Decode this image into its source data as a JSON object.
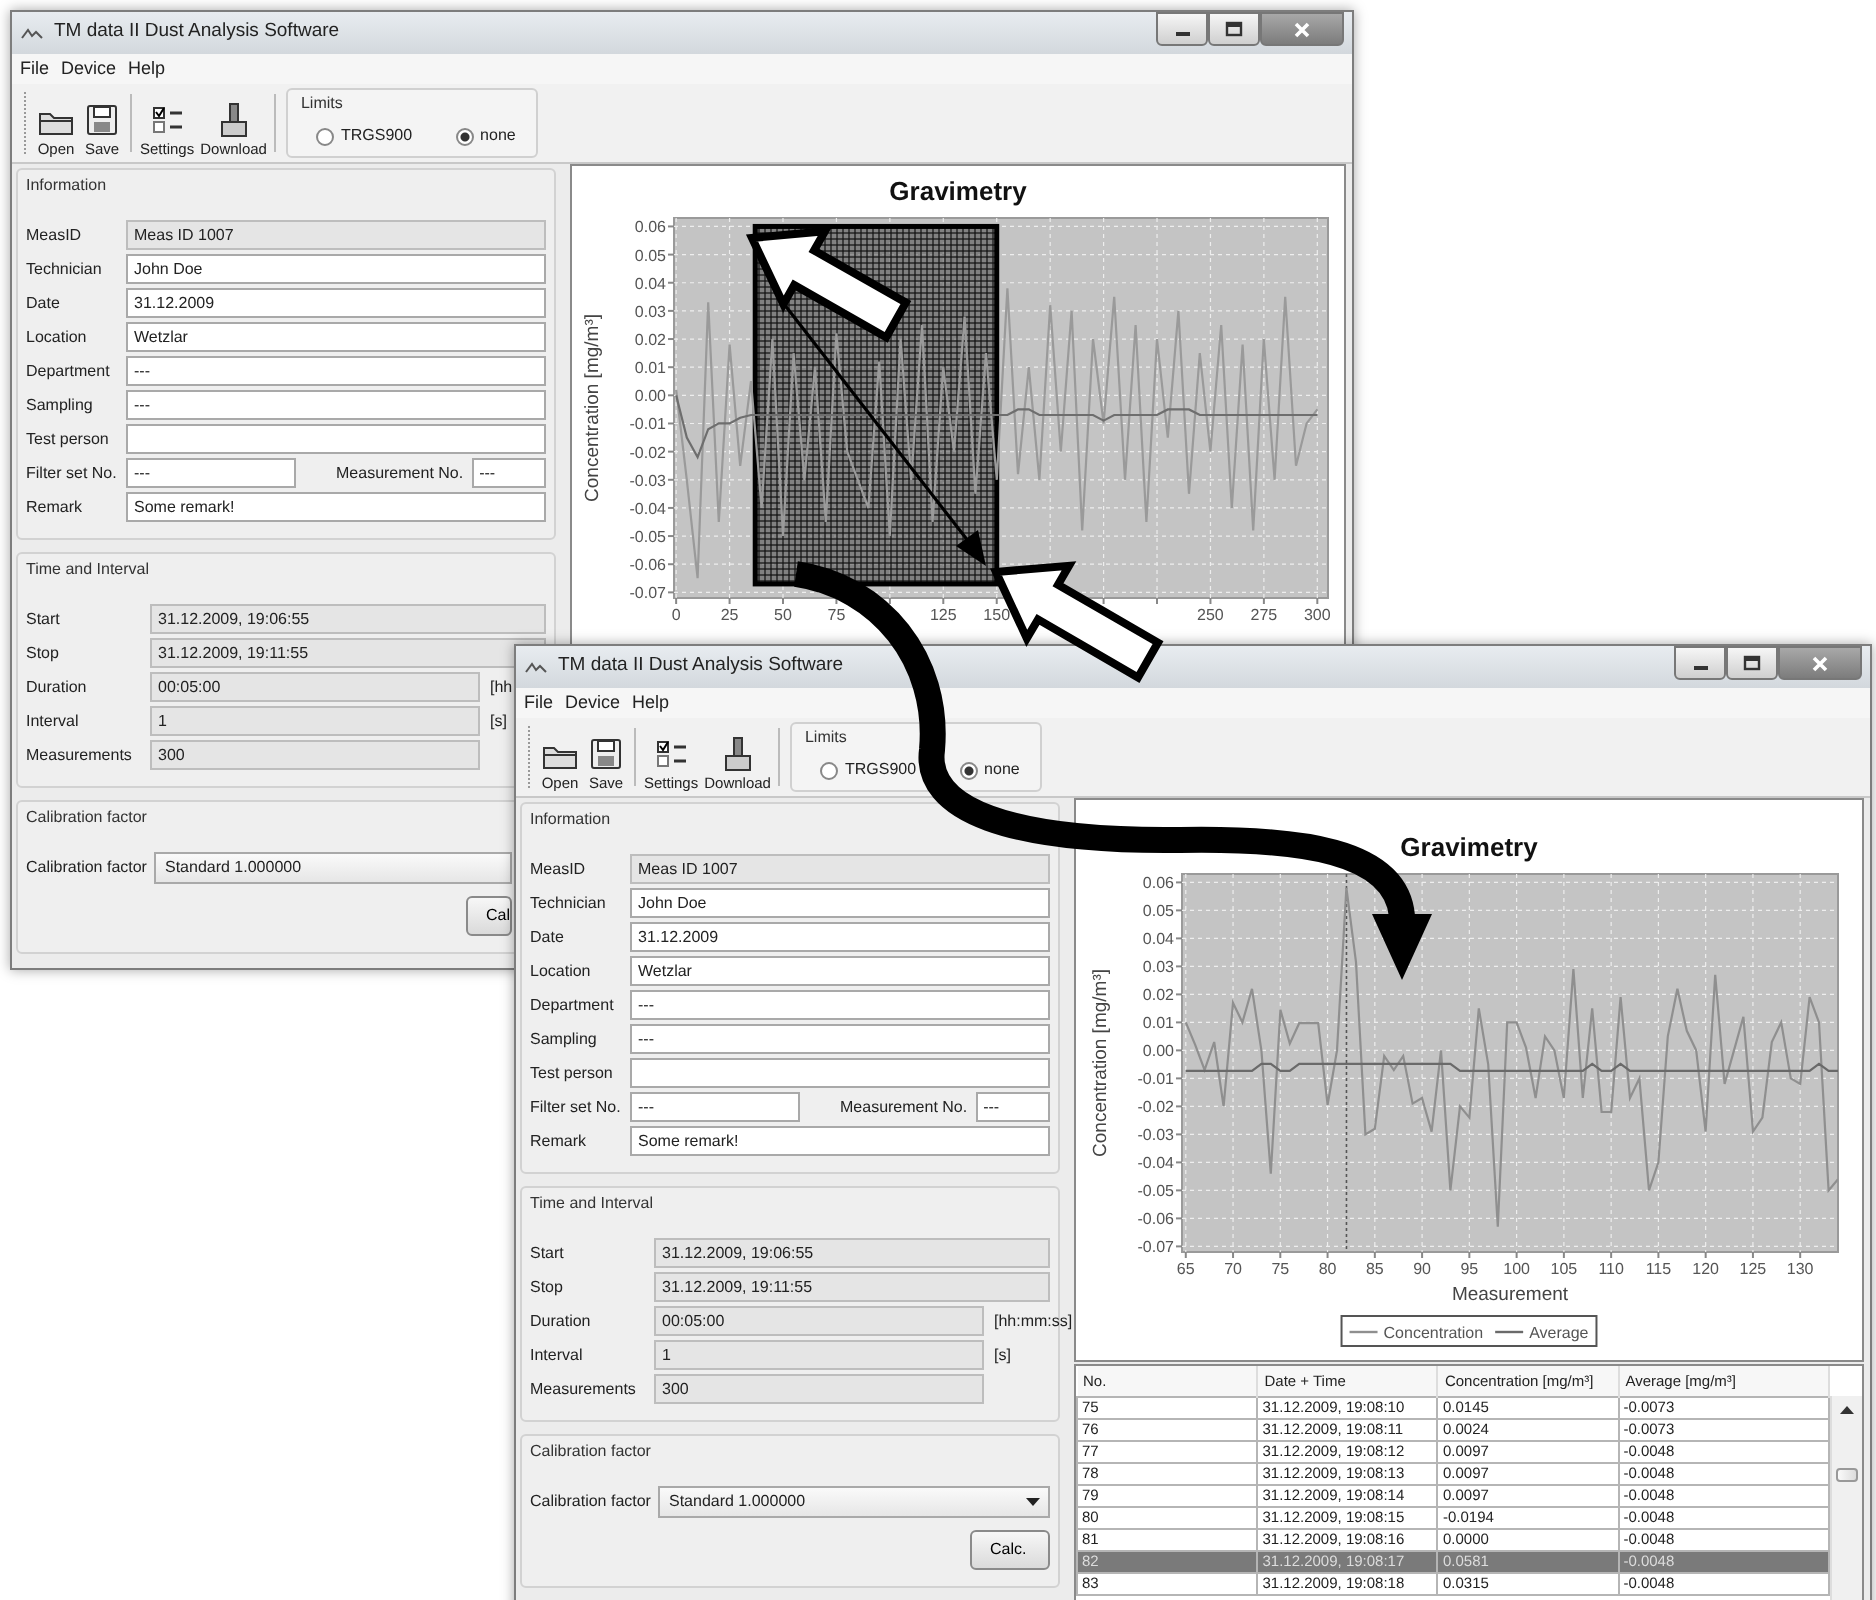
{
  "windows": [
    {
      "title": "TM data II Dust Analysis Software",
      "menu": [
        "File",
        "Device",
        "Help"
      ],
      "toolbar": [
        {
          "kind": "open",
          "label": "Open"
        },
        {
          "kind": "save",
          "label": "Save"
        },
        {
          "kind": "settings",
          "label": "Settings"
        },
        {
          "kind": "download",
          "label": "Download"
        }
      ],
      "limits": {
        "title": "Limits",
        "options": [
          {
            "label": "TRGS900",
            "selected": false
          },
          {
            "label": "none",
            "selected": true
          }
        ]
      },
      "information": {
        "title": "Information",
        "fields": [
          {
            "label": "MeasID",
            "value": "Meas ID 1007",
            "readonly": true
          },
          {
            "label": "Technician",
            "value": "John Doe",
            "readonly": false
          },
          {
            "label": "Date",
            "value": "31.12.2009",
            "readonly": false
          },
          {
            "label": "Location",
            "value": "Wetzlar",
            "readonly": false
          },
          {
            "label": "Department",
            "value": "---",
            "readonly": false
          },
          {
            "label": "Sampling",
            "value": "---",
            "readonly": false
          },
          {
            "label": "Test person",
            "readonly": false
          },
          {
            "label": "Filter set No.",
            "value": "---",
            "readonly": false,
            "extra": {
              "label": "Measurement No.",
              "value": "---",
              "readonly": false
            }
          },
          {
            "label": "Remark",
            "value": "Some remark!",
            "readonly": false
          }
        ]
      },
      "time": {
        "title": "Time and Interval",
        "fields": [
          {
            "kind": "wide",
            "label": "Start",
            "value": "31.12.2009, 19:06:55",
            "readonly": true
          },
          {
            "kind": "wide",
            "label": "Stop",
            "value": "31.12.2009, 19:11:55",
            "readonly": true
          },
          {
            "kind": "short",
            "label": "Duration",
            "value": "00:05:00",
            "unit": "[hh",
            "readonly": true
          },
          {
            "kind": "short",
            "label": "Interval",
            "value": "1",
            "unit": "[s]",
            "readonly": true
          },
          {
            "kind": "short",
            "label": "Measurements",
            "value": "300",
            "readonly": true
          }
        ]
      },
      "calibration": {
        "title": "Calibration factor",
        "label": "Calibration factor",
        "value": "Standard 1.000000"
      },
      "calc_button": "Cal",
      "chart_data": {
        "type": "line",
        "title": "Gravimetry",
        "ylabel": "Concentration [mg/m³]",
        "grid": true,
        "x": [
          0,
          5,
          10,
          15,
          20,
          25,
          30,
          35,
          40,
          45,
          50,
          55,
          60,
          65,
          70,
          75,
          80,
          85,
          90,
          95,
          100,
          105,
          110,
          115,
          120,
          125,
          130,
          135,
          140,
          145,
          150,
          155,
          160,
          165,
          170,
          175,
          180,
          185,
          190,
          195,
          200,
          205,
          210,
          215,
          220,
          225,
          230,
          235,
          240,
          245,
          250,
          255,
          260,
          265,
          270,
          275,
          280,
          285,
          290,
          295,
          300
        ],
        "series": [
          {
            "color": "#9a9a9a",
            "values": [
              0.002,
              -0.03,
              -0.065,
              0.033,
              -0.045,
              0.018,
              -0.025,
              0.005,
              -0.04,
              0.02,
              -0.05,
              0.015,
              -0.03,
              0.01,
              -0.045,
              0.022,
              -0.02,
              null,
              -0.04,
              0.012,
              -0.05,
              0.02,
              -0.03,
              0.025,
              -0.045,
              0.01,
              -0.02,
              0.028,
              -0.035,
              0.015,
              -0.03,
              0.038,
              -0.028,
              0.01,
              -0.03,
              0.032,
              -0.02,
              0.03,
              -0.048,
              0.02,
              -0.01,
              0.035,
              -0.03,
              0.025,
              -0.045,
              0.02,
              -0.015,
              0.03,
              -0.035,
              0.015,
              -0.02,
              0.025,
              -0.04,
              0.018,
              -0.048,
              0.02,
              -0.03,
              0.035,
              -0.025,
              -0.01,
              -0.005
            ]
          },
          {
            "color": "#6e6e6e",
            "values": [
              0.0,
              -0.015,
              -0.022,
              -0.012,
              -0.01,
              -0.01,
              -0.008,
              -0.007,
              -0.007,
              -0.007,
              -0.007,
              -0.007,
              -0.007,
              -0.007,
              -0.007,
              -0.007,
              -0.007,
              -0.007,
              -0.007,
              -0.007,
              -0.007,
              -0.007,
              -0.007,
              -0.007,
              -0.007,
              -0.007,
              -0.007,
              -0.007,
              -0.007,
              -0.007,
              -0.007,
              -0.007,
              -0.005,
              -0.005,
              -0.007,
              -0.007,
              -0.007,
              -0.007,
              -0.007,
              -0.007,
              -0.009,
              -0.007,
              -0.007,
              -0.007,
              -0.007,
              -0.007,
              -0.005,
              -0.005,
              -0.005,
              -0.007,
              -0.007,
              -0.007,
              -0.007,
              -0.007,
              -0.007,
              -0.007,
              -0.007,
              -0.007,
              -0.007,
              -0.007,
              -0.007
            ]
          }
        ],
        "xlim": [
          -1,
          305
        ],
        "ylim": [
          -0.072,
          0.063
        ],
        "xticks": [
          0,
          25,
          50,
          75,
          125,
          150,
          250,
          275,
          300
        ],
        "yticks": [
          {
            "value": 0.06,
            "label": "0.06"
          },
          {
            "value": 0.05,
            "label": "0.05"
          },
          {
            "value": 0.04,
            "label": "0.04"
          },
          {
            "value": 0.03,
            "label": "0.03"
          },
          {
            "value": 0.02,
            "label": "0.02"
          },
          {
            "value": 0.01,
            "label": "0.01"
          },
          {
            "value": 0,
            "label": "0.00"
          },
          {
            "value": -0.01,
            "label": "-0.01"
          },
          {
            "value": -0.02,
            "label": "-0.02"
          },
          {
            "value": -0.03,
            "label": "-0.03"
          },
          {
            "value": -0.04,
            "label": "-0.04"
          },
          {
            "value": -0.05,
            "label": "-0.05"
          },
          {
            "value": -0.06,
            "label": "-0.06"
          },
          {
            "value": -0.07,
            "label": "-0.07"
          }
        ]
      }
    },
    {
      "title": "TM data II Dust Analysis Software",
      "menu": [
        "File",
        "Device",
        "Help"
      ],
      "toolbar": [
        {
          "kind": "open",
          "label": "Open"
        },
        {
          "kind": "save",
          "label": "Save"
        },
        {
          "kind": "settings",
          "label": "Settings"
        },
        {
          "kind": "download",
          "label": "Download"
        }
      ],
      "limits": {
        "title": "Limits",
        "options": [
          {
            "label": "TRGS900",
            "selected": false
          },
          {
            "label": "none",
            "selected": true
          }
        ]
      },
      "information": {
        "title": "Information",
        "fields": [
          {
            "label": "MeasID",
            "value": "Meas ID 1007",
            "readonly": true
          },
          {
            "label": "Technician",
            "value": "John Doe",
            "readonly": false
          },
          {
            "label": "Date",
            "value": "31.12.2009",
            "readonly": false
          },
          {
            "label": "Location",
            "value": "Wetzlar",
            "readonly": false
          },
          {
            "label": "Department",
            "value": "---",
            "readonly": false
          },
          {
            "label": "Sampling",
            "value": "---",
            "readonly": false
          },
          {
            "label": "Test person",
            "readonly": false
          },
          {
            "label": "Filter set No.",
            "value": "---",
            "readonly": false,
            "extra": {
              "label": "Measurement No.",
              "value": "---",
              "readonly": false
            }
          },
          {
            "label": "Remark",
            "value": "Some remark!",
            "readonly": false
          }
        ]
      },
      "time": {
        "title": "Time and Interval",
        "fields": [
          {
            "kind": "wide",
            "label": "Start",
            "value": "31.12.2009, 19:06:55",
            "readonly": true
          },
          {
            "kind": "wide",
            "label": "Stop",
            "value": "31.12.2009, 19:11:55",
            "readonly": true
          },
          {
            "kind": "short",
            "label": "Duration",
            "value": "00:05:00",
            "unit": "[hh:mm:ss]",
            "readonly": true
          },
          {
            "kind": "short",
            "label": "Interval",
            "value": "1",
            "unit": "[s]",
            "readonly": true
          },
          {
            "kind": "short",
            "label": "Measurements",
            "value": "300",
            "readonly": true
          }
        ]
      },
      "calibration": {
        "title": "Calibration factor",
        "label": "Calibration factor",
        "value": "Standard 1.000000"
      },
      "calc_button": "Calc.",
      "chart_data": {
        "type": "line",
        "title": "Gravimetry",
        "xlabel": "Measurement",
        "ylabel": "Concentration [mg/m³]",
        "grid": true,
        "legend": "bottom",
        "x": [
          65,
          66,
          67,
          68,
          69,
          70,
          71,
          72,
          73,
          74,
          75,
          76,
          77,
          78,
          79,
          80,
          81,
          82,
          83,
          84,
          85,
          86,
          87,
          88,
          89,
          90,
          91,
          92,
          93,
          94,
          95,
          96,
          97,
          98,
          99,
          100,
          101,
          102,
          103,
          104,
          105,
          106,
          107,
          108,
          109,
          110,
          111,
          112,
          113,
          114,
          115,
          116,
          117,
          118,
          119,
          120,
          121,
          122,
          123,
          124,
          125,
          126,
          127,
          128,
          129,
          130,
          131,
          132,
          133,
          134
        ],
        "series": [
          {
            "name": "Concentration",
            "color": "#8f8f8f",
            "values": [
              0.01,
              0.002,
              -0.007,
              0.003,
              -0.02,
              0.017,
              0.01,
              0.022,
              0.0,
              -0.044,
              0.0145,
              0.0024,
              0.0097,
              0.0097,
              0.0097,
              -0.0194,
              0.0,
              0.0581,
              0.0315,
              -0.03,
              -0.028,
              -0.002,
              -0.007,
              -0.002,
              -0.019,
              -0.017,
              -0.029,
              0.0,
              -0.05,
              -0.02,
              -0.024,
              0.015,
              -0.005,
              -0.063,
              0.01,
              0.01,
              0.001,
              -0.017,
              0.005,
              0.0,
              -0.017,
              0.029,
              -0.017,
              0.015,
              -0.022,
              -0.022,
              0.019,
              -0.017,
              -0.01,
              -0.05,
              -0.04,
              0.005,
              0.022,
              0.007,
              0.0,
              -0.029,
              0.027,
              -0.012,
              0.0,
              0.012,
              -0.029,
              -0.024,
              0.003,
              0.01,
              -0.01,
              -0.012,
              0.019,
              0.01,
              -0.05,
              -0.046
            ]
          },
          {
            "name": "Average",
            "color": "#6a6a6a",
            "values": [
              -0.0073,
              -0.0073,
              -0.0073,
              -0.0073,
              -0.0073,
              -0.0073,
              -0.0073,
              -0.0073,
              -0.0048,
              -0.0048,
              -0.0073,
              -0.0073,
              -0.0048,
              -0.0048,
              -0.0048,
              -0.0048,
              -0.0048,
              -0.0048,
              -0.0048,
              -0.0048,
              -0.0048,
              -0.0048,
              -0.0048,
              -0.0048,
              -0.0048,
              -0.0048,
              -0.0048,
              -0.0048,
              -0.0048,
              -0.0073,
              -0.0073,
              -0.0073,
              -0.0073,
              -0.0073,
              -0.0073,
              -0.0073,
              -0.0073,
              -0.0073,
              -0.0073,
              -0.0073,
              -0.0073,
              -0.0073,
              -0.0073,
              -0.0048,
              -0.0073,
              -0.0073,
              -0.0048,
              -0.0073,
              -0.0073,
              -0.0073,
              -0.0073,
              -0.0073,
              -0.0073,
              -0.0073,
              -0.0073,
              -0.0073,
              -0.0073,
              -0.0073,
              -0.0073,
              -0.0073,
              -0.0073,
              -0.0073,
              -0.0073,
              -0.0073,
              -0.0073,
              -0.0073,
              -0.0073,
              -0.0048,
              -0.0073,
              -0.0073
            ]
          }
        ],
        "xlim": [
          64.6,
          134
        ],
        "ylim": [
          -0.072,
          0.063
        ],
        "xticks": [
          65,
          70,
          75,
          80,
          85,
          90,
          95,
          100,
          105,
          110,
          115,
          120,
          125,
          130
        ],
        "yticks": [
          {
            "value": 0.06,
            "label": "0.06"
          },
          {
            "value": 0.05,
            "label": "0.05"
          },
          {
            "value": 0.04,
            "label": "0.04"
          },
          {
            "value": 0.03,
            "label": "0.03"
          },
          {
            "value": 0.02,
            "label": "0.02"
          },
          {
            "value": 0.01,
            "label": "0.01"
          },
          {
            "value": 0,
            "label": "0.00"
          },
          {
            "value": -0.01,
            "label": "-0.01"
          },
          {
            "value": -0.02,
            "label": "-0.02"
          },
          {
            "value": -0.03,
            "label": "-0.03"
          },
          {
            "value": -0.04,
            "label": "-0.04"
          },
          {
            "value": -0.05,
            "label": "-0.05"
          },
          {
            "value": -0.06,
            "label": "-0.06"
          },
          {
            "value": -0.07,
            "label": "-0.07"
          }
        ],
        "ref_lines": [
          {
            "axis": "x",
            "value": 82
          }
        ]
      },
      "table": {
        "columns": [
          "No.",
          "Date + Time",
          "Concentration [mg/m³]",
          "Average [mg/m³]"
        ],
        "rows": [
          {
            "cells": [
              "75",
              "31.12.2009, 19:08:10",
              "0.0145",
              "-0.0073"
            ],
            "selected": false
          },
          {
            "cells": [
              "76",
              "31.12.2009, 19:08:11",
              "0.0024",
              "-0.0073"
            ],
            "selected": false
          },
          {
            "cells": [
              "77",
              "31.12.2009, 19:08:12",
              "0.0097",
              "-0.0048"
            ],
            "selected": false
          },
          {
            "cells": [
              "78",
              "31.12.2009, 19:08:13",
              "0.0097",
              "-0.0048"
            ],
            "selected": false
          },
          {
            "cells": [
              "79",
              "31.12.2009, 19:08:14",
              "0.0097",
              "-0.0048"
            ],
            "selected": false
          },
          {
            "cells": [
              "80",
              "31.12.2009, 19:08:15",
              "-0.0194",
              "-0.0048"
            ],
            "selected": false
          },
          {
            "cells": [
              "81",
              "31.12.2009, 19:08:16",
              "0.0000",
              "-0.0048"
            ],
            "selected": false
          },
          {
            "cells": [
              "82",
              "31.12.2009, 19:08:17",
              "0.0581",
              "-0.0048"
            ],
            "selected": true
          },
          {
            "cells": [
              "83",
              "31.12.2009, 19:08:18",
              "0.0315",
              "-0.0048"
            ],
            "selected": false
          }
        ]
      }
    }
  ]
}
